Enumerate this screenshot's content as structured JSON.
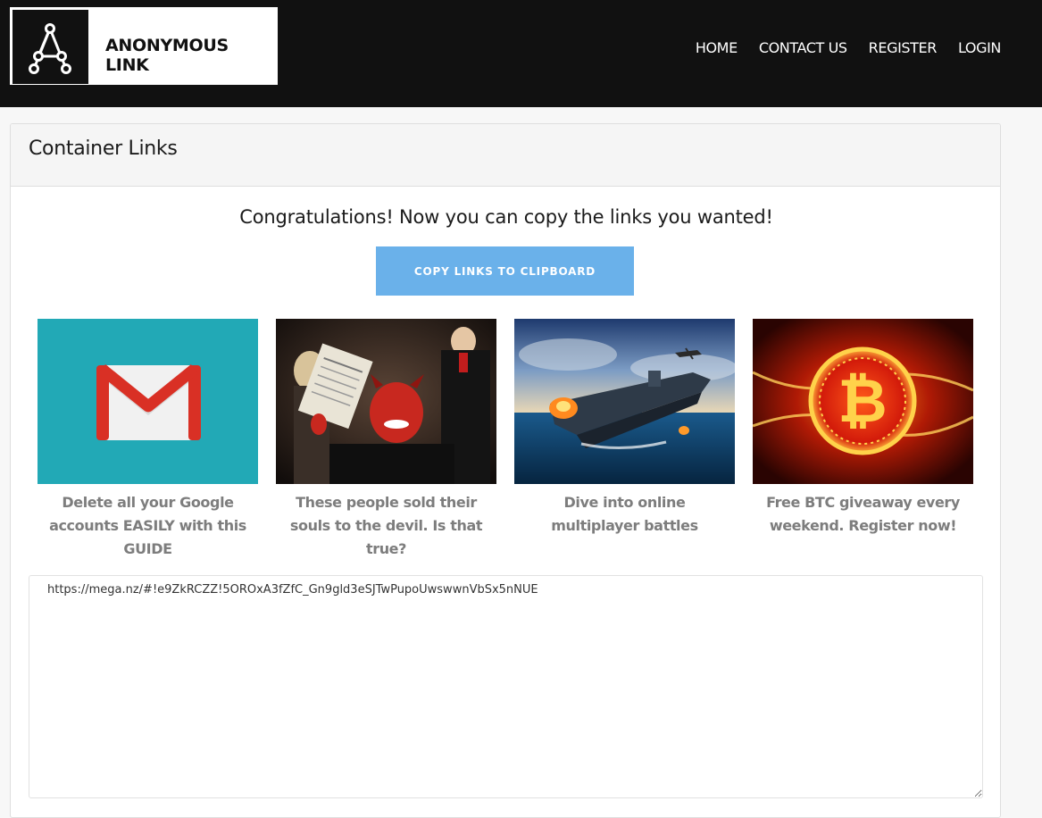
{
  "brand": {
    "name": "ANONYMOUS LINK",
    "logo_icon": "triangle-a-icon"
  },
  "nav": [
    {
      "label": "HOME"
    },
    {
      "label": "CONTACT US"
    },
    {
      "label": "REGISTER"
    },
    {
      "label": "LOGIN"
    }
  ],
  "card": {
    "title": "Container Links",
    "message": "Congratulations! Now you can copy the links you wanted!",
    "copy_button": "COPY LINKS TO CLIPBOARD",
    "links_text": "https://mega.nz/#!e9ZkRCZZ!5OROxA3fZfC_Gn9gld3eSJTwPupoUwswwnVbSx5nNUE"
  },
  "tiles": [
    {
      "caption": "Delete all your Google accounts EASILY with this GUIDE",
      "image": "gmail-logo-image"
    },
    {
      "caption": "These people sold their souls to the devil. Is that true?",
      "image": "devil-signing-contract-image"
    },
    {
      "caption": "Dive into online multiplayer battles",
      "image": "warship-battle-image"
    },
    {
      "caption": "Free BTC giveaway every weekend. Register now!",
      "image": "bitcoin-fire-image"
    }
  ],
  "colors": {
    "topbar": "#111111",
    "button": "#6ab1ea",
    "caption": "#7d7d7d",
    "gmail_bg": "#22a9b6"
  }
}
